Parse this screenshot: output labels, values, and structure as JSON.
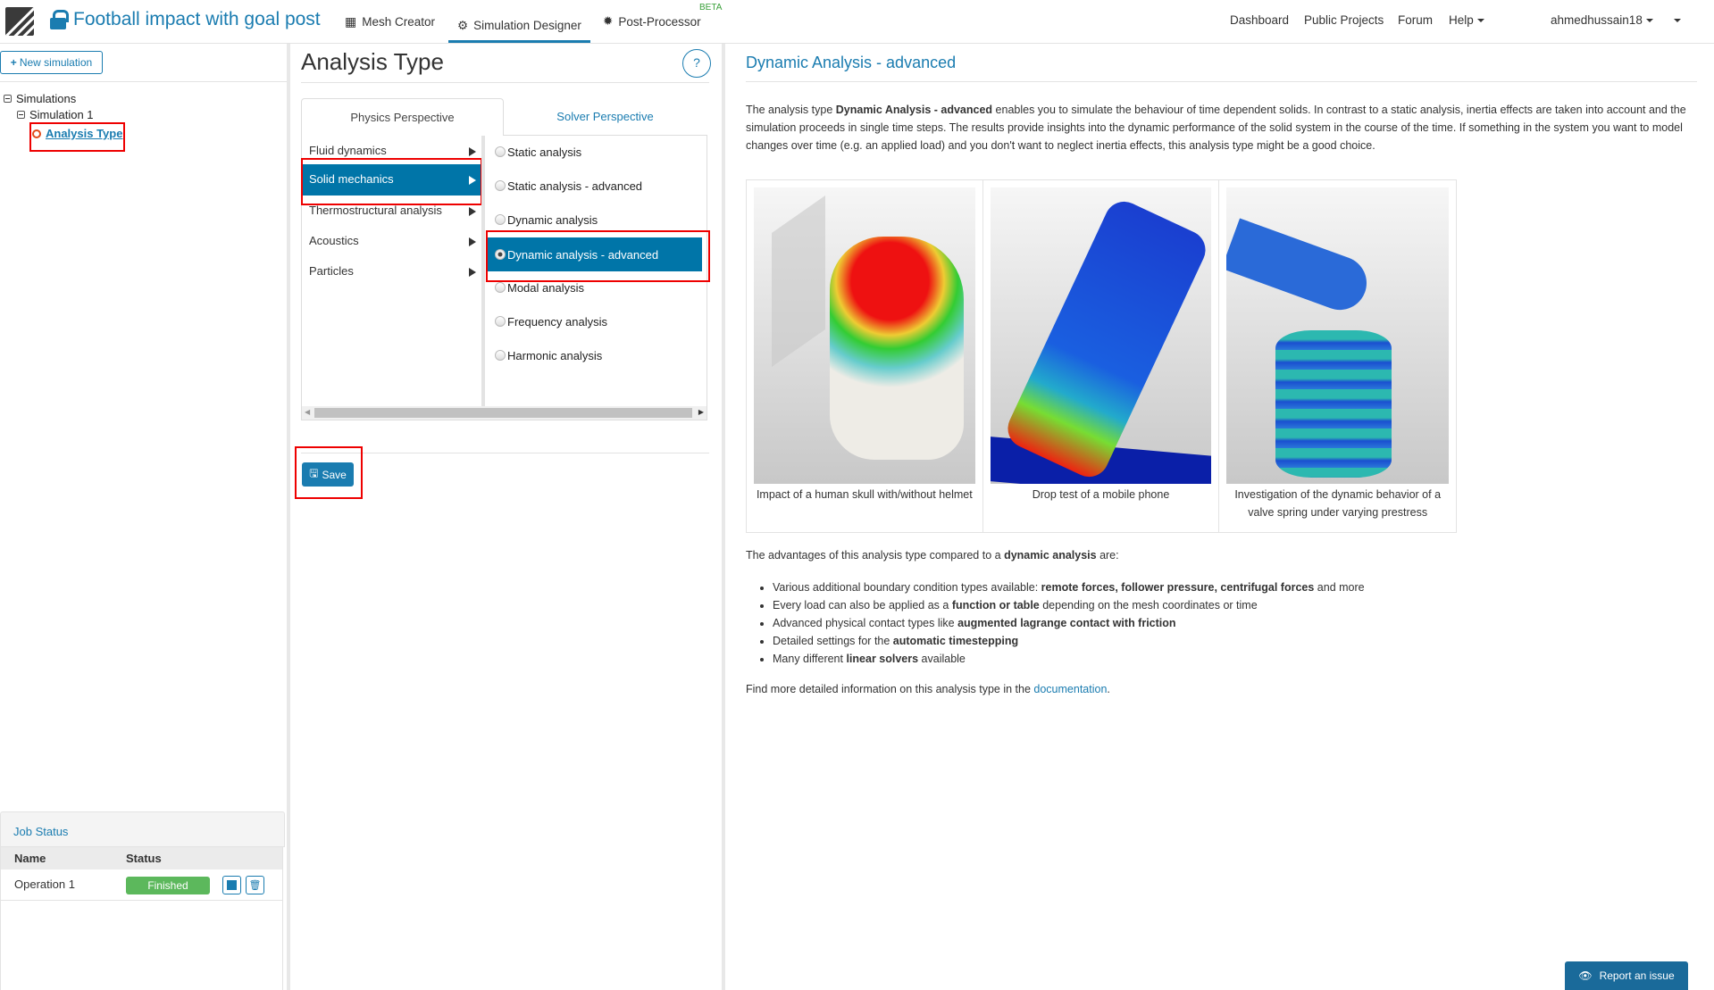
{
  "header": {
    "project_title": "Football impact with goal post",
    "tabs": [
      {
        "label": "Mesh Creator",
        "icon": "grid-icon"
      },
      {
        "label": "Simulation Designer",
        "icon": "gears-icon",
        "active": true
      },
      {
        "label": "Post-Processor",
        "icon": "cog-icon",
        "badge": "BETA"
      }
    ],
    "links": [
      "Dashboard",
      "Public Projects",
      "Forum",
      "Help"
    ],
    "user": "ahmedhussain18"
  },
  "sidebar": {
    "new_simulation": "New simulation",
    "tree": {
      "root": "Simulations",
      "simulation": "Simulation 1",
      "node": "Analysis Type"
    },
    "job_status": {
      "title": "Job Status",
      "columns": [
        "Name",
        "Status"
      ],
      "rows": [
        {
          "name": "Operation 1",
          "status": "Finished"
        }
      ]
    }
  },
  "middle": {
    "title": "Analysis Type",
    "help": "?",
    "tabs": [
      "Physics Perspective",
      "Solver Perspective"
    ],
    "categories": [
      "Fluid dynamics",
      "Solid mechanics",
      "Thermostructural analysis",
      "Acoustics",
      "Particles"
    ],
    "selected_category": "Solid mechanics",
    "analysis_types": [
      "Static analysis",
      "Static analysis - advanced",
      "Dynamic analysis",
      "Dynamic analysis - advanced",
      "Modal analysis",
      "Frequency analysis",
      "Harmonic analysis"
    ],
    "selected_type": "Dynamic analysis - advanced",
    "save": "Save"
  },
  "right": {
    "title": "Dynamic Analysis - advanced",
    "intro": {
      "a": "The analysis type ",
      "b": "Dynamic Analysis - advanced",
      "c": " enables you to simulate the behaviour of time dependent solids. In contrast to a static analysis, inertia effects are taken into account and the simulation proceeds in single time steps. The results provide insights into the dynamic performance of the solid system in the course of the time. If something in the system you want to model changes over time (e.g. an applied load) and you don't want to neglect inertia effects, this analysis type might be a good choice."
    },
    "captions": [
      "Impact of a human skull with/without helmet",
      "Drop test of a mobile phone",
      "Investigation of the dynamic behavior of a valve spring under varying prestress"
    ],
    "adv_intro": {
      "a": "The advantages of this analysis type compared to a ",
      "b": "dynamic analysis",
      "c": " are:"
    },
    "advantages": [
      {
        "a": "Various additional boundary condition types available: ",
        "b": "remote forces, follower pressure, centrifugal forces",
        "c": " and more"
      },
      {
        "a": "Every load can also be applied as a ",
        "b": "function or table",
        "c": " depending on the mesh coordinates or time"
      },
      {
        "a": "Advanced physical contact types like ",
        "b": "augmented lagrange contact with friction",
        "c": ""
      },
      {
        "a": "Detailed settings for the ",
        "b": "automatic timestepping",
        "c": ""
      },
      {
        "a": "Many different ",
        "b": "linear solvers",
        "c": " available"
      }
    ],
    "more": {
      "a": "Find more detailed information on this analysis type in the ",
      "link": "documentation",
      "c": "."
    },
    "report": "Report an issue"
  },
  "colors": {
    "accent": "#1a7cb0",
    "selected": "#0075a8",
    "success": "#5cb85c",
    "highlight_box": "#e00000"
  }
}
